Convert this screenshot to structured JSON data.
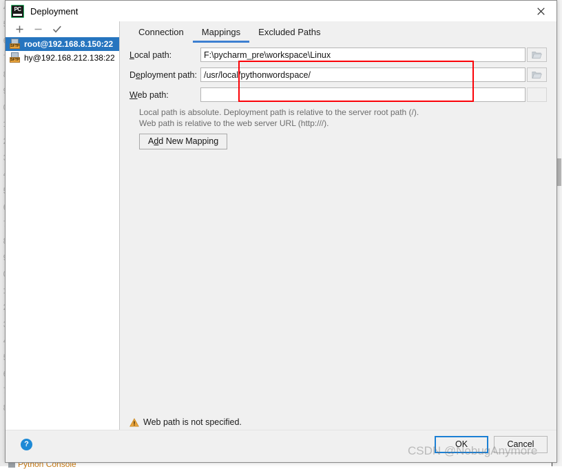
{
  "window": {
    "title": "Deployment",
    "app_icon": "pycharm-icon",
    "close_label": "✕"
  },
  "left_panel": {
    "toolbar": [
      {
        "name": "add-server-button",
        "glyph": "+"
      },
      {
        "name": "remove-server-button",
        "glyph": "−"
      },
      {
        "name": "set-default-server-button",
        "glyph": "✓"
      }
    ],
    "servers": [
      {
        "label": "root@192.168.8.150:22",
        "badge": "SFTP",
        "selected": true
      },
      {
        "label": "hy@192.168.212.138:22",
        "badge": "SFTP",
        "selected": false
      }
    ]
  },
  "tabs": [
    {
      "label": "Connection",
      "active": false
    },
    {
      "label": "Mappings",
      "active": true
    },
    {
      "label": "Excluded Paths",
      "active": false
    }
  ],
  "form": {
    "rows": [
      {
        "label_pre": "",
        "label_accel": "L",
        "label_post": "ocal path:",
        "value": "F:\\pycharm_pre\\workspace\\Linux",
        "placeholder": "",
        "browse": true,
        "browse_icon": "folder-icon"
      },
      {
        "label_pre": "D",
        "label_accel": "e",
        "label_post": "ployment path:",
        "value": "/usr/local/pythonwordspace/",
        "placeholder": "",
        "browse": true,
        "browse_icon": "folder-icon"
      },
      {
        "label_pre": "",
        "label_accel": "W",
        "label_post": "eb path:",
        "value": "",
        "placeholder": "",
        "browse": false,
        "browse_icon": ""
      }
    ],
    "hint_line1": "Local path is absolute. Deployment path is relative to the server root path (/).",
    "hint_line2": "Web path is relative to the web server URL (http:///).",
    "add_mapping_pre": "A",
    "add_mapping_accel": "d",
    "add_mapping_post": "d New Mapping"
  },
  "status": {
    "icon": "warning-icon",
    "message": "Web path is not specified."
  },
  "footer": {
    "help_label": "?",
    "ok_label": "OK",
    "cancel_label": "Cancel"
  },
  "watermark": "CSDN @NobugAnymore",
  "background": {
    "line_numbers": [
      "4",
      "5",
      "6",
      "7",
      "8",
      "9",
      "0",
      "1",
      "2",
      "3",
      "4",
      "5",
      "6",
      "7",
      "8",
      "9",
      "0",
      "1",
      "2",
      "3",
      "4",
      "5",
      "6",
      "7",
      "8"
    ],
    "bottom_text": "Python Console"
  },
  "colors": {
    "selection_blue": "#2675bf",
    "tab_underline": "#3d7fd1",
    "annotation_red": "#fb0006",
    "warning_orange": "#e8a33d",
    "help_blue": "#1e8ad6",
    "focus_blue": "#1a7fd4"
  }
}
